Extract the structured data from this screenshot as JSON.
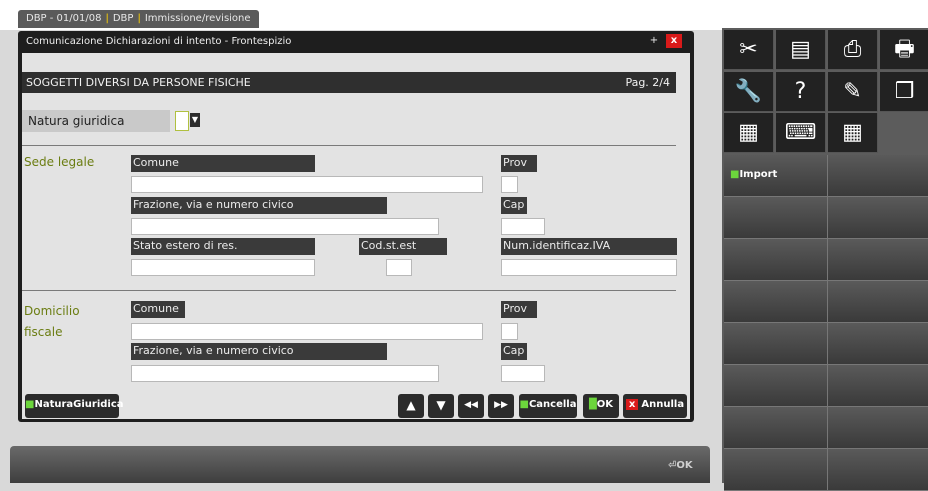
{
  "tab": {
    "part1": "DBP - 01/01/08",
    "part2": "DBP",
    "part3": "Immissione/revisione"
  },
  "window": {
    "title": "Comunicazione Dichiarazioni di intento - Frontespizio",
    "expand_icon": "+",
    "close_icon": "x"
  },
  "heading": {
    "title": "SOGGETTI DIVERSI DA PERSONE FISICHE",
    "page": "Pag. 2/4"
  },
  "natura": {
    "label": "Natura giuridica",
    "value": ""
  },
  "sede": {
    "section_label": "Sede legale",
    "comune_label": "Comune",
    "prov_label": "Prov",
    "frazione_label": "Frazione, via e numero civico",
    "cap_label": "Cap",
    "stato_label": "Stato estero di res.",
    "codst_label": "Cod.st.est",
    "numiva_label": "Num.identificaz.IVA"
  },
  "domicilio": {
    "section_label_1": "Domicilio",
    "section_label_2": "fiscale",
    "comune_label": "Comune",
    "prov_label": "Prov",
    "frazione_label": "Frazione, via e numero civico",
    "cap_label": "Cap"
  },
  "buttons": {
    "natura": "NaturaGiuridica",
    "cancella": "Cancella",
    "ok": "OK",
    "annulla": "Annulla",
    "annulla_icon": "x"
  },
  "nav": {
    "up": "▲",
    "down": "▼",
    "rew": "◀◀",
    "fwd": "▶▶"
  },
  "bottom": {
    "ok": "OK"
  },
  "right_panel": {
    "icons": [
      "scissors-icon",
      "document-icon",
      "printer-feed-icon",
      "printer-icon",
      "wrench-icon",
      "help-icon",
      "edit-icon",
      "box-icon",
      "calculator-icon",
      "keyboard-icon",
      "grid-icon"
    ],
    "glyphs": [
      "✂",
      "▤",
      "⎙",
      "🖶",
      "🔧",
      "?",
      "✎",
      "❒",
      "▦",
      "⌨",
      "▦"
    ],
    "import_label": "Import"
  },
  "colors": {
    "accent_green": "#6cd63c",
    "close_red": "#d91a1a",
    "section_olive": "#6b7d12"
  }
}
